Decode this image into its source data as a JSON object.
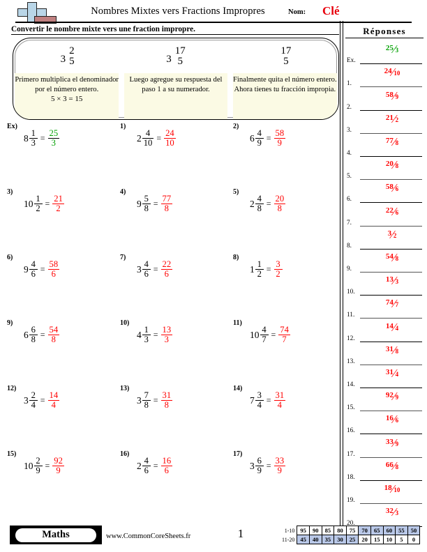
{
  "header": {
    "title": "Nombres Mixtes vers Fractions Impropres",
    "name_label": "Nom:",
    "name_value": "Clé",
    "logo_icon": "plus-book-icon"
  },
  "instruction": "Convertir le nombre mixte vers une fraction impropre.",
  "steps": [
    {
      "whole": "3",
      "num": "2",
      "den": "5",
      "text": "Primero multiplica el denominador por el número entero.",
      "calc": "5 × 3 = 15"
    },
    {
      "whole": "3",
      "num": "17",
      "den": "5",
      "text": "Luego agregue su respuesta del paso 1 a su numerador.",
      "calc": ""
    },
    {
      "whole": "",
      "num": "17",
      "den": "5",
      "text": "Finalmente quita el número entero. Ahora tienes tu fracción impropia.",
      "calc": ""
    }
  ],
  "problems": [
    {
      "num": "Ex)",
      "whole": "8",
      "n": "1",
      "d": "3",
      "an": "25",
      "ad": "3",
      "color": "green"
    },
    {
      "num": "1)",
      "whole": "2",
      "n": "4",
      "d": "10",
      "an": "24",
      "ad": "10",
      "color": "red"
    },
    {
      "num": "2)",
      "whole": "6",
      "n": "4",
      "d": "9",
      "an": "58",
      "ad": "9",
      "color": "red"
    },
    {
      "num": "3)",
      "whole": "10",
      "n": "1",
      "d": "2",
      "an": "21",
      "ad": "2",
      "color": "red"
    },
    {
      "num": "4)",
      "whole": "9",
      "n": "5",
      "d": "8",
      "an": "77",
      "ad": "8",
      "color": "red"
    },
    {
      "num": "5)",
      "whole": "2",
      "n": "4",
      "d": "8",
      "an": "20",
      "ad": "8",
      "color": "red"
    },
    {
      "num": "6)",
      "whole": "9",
      "n": "4",
      "d": "6",
      "an": "58",
      "ad": "6",
      "color": "red"
    },
    {
      "num": "7)",
      "whole": "3",
      "n": "4",
      "d": "6",
      "an": "22",
      "ad": "6",
      "color": "red"
    },
    {
      "num": "8)",
      "whole": "1",
      "n": "1",
      "d": "2",
      "an": "3",
      "ad": "2",
      "color": "red"
    },
    {
      "num": "9)",
      "whole": "6",
      "n": "6",
      "d": "8",
      "an": "54",
      "ad": "8",
      "color": "red"
    },
    {
      "num": "10)",
      "whole": "4",
      "n": "1",
      "d": "3",
      "an": "13",
      "ad": "3",
      "color": "red"
    },
    {
      "num": "11)",
      "whole": "10",
      "n": "4",
      "d": "7",
      "an": "74",
      "ad": "7",
      "color": "red"
    },
    {
      "num": "12)",
      "whole": "3",
      "n": "2",
      "d": "4",
      "an": "14",
      "ad": "4",
      "color": "red"
    },
    {
      "num": "13)",
      "whole": "3",
      "n": "7",
      "d": "8",
      "an": "31",
      "ad": "8",
      "color": "red"
    },
    {
      "num": "14)",
      "whole": "7",
      "n": "3",
      "d": "4",
      "an": "31",
      "ad": "4",
      "color": "red"
    },
    {
      "num": "15)",
      "whole": "10",
      "n": "2",
      "d": "9",
      "an": "92",
      "ad": "9",
      "color": "red"
    },
    {
      "num": "16)",
      "whole": "2",
      "n": "4",
      "d": "6",
      "an": "16",
      "ad": "6",
      "color": "red"
    },
    {
      "num": "17)",
      "whole": "3",
      "n": "6",
      "d": "9",
      "an": "33",
      "ad": "9",
      "color": "red"
    }
  ],
  "answers": {
    "title": "Réponses",
    "rows": [
      {
        "label": "Ex.",
        "n": "25",
        "d": "3",
        "color": "green"
      },
      {
        "label": "1.",
        "n": "24",
        "d": "10",
        "color": "red"
      },
      {
        "label": "2.",
        "n": "58",
        "d": "9",
        "color": "red"
      },
      {
        "label": "3.",
        "n": "21",
        "d": "2",
        "color": "red"
      },
      {
        "label": "4.",
        "n": "77",
        "d": "8",
        "color": "red"
      },
      {
        "label": "5.",
        "n": "20",
        "d": "8",
        "color": "red"
      },
      {
        "label": "6.",
        "n": "58",
        "d": "6",
        "color": "red"
      },
      {
        "label": "7.",
        "n": "22",
        "d": "6",
        "color": "red"
      },
      {
        "label": "8.",
        "n": "3",
        "d": "2",
        "color": "red"
      },
      {
        "label": "9.",
        "n": "54",
        "d": "8",
        "color": "red"
      },
      {
        "label": "10.",
        "n": "13",
        "d": "3",
        "color": "red"
      },
      {
        "label": "11.",
        "n": "74",
        "d": "7",
        "color": "red"
      },
      {
        "label": "12.",
        "n": "14",
        "d": "4",
        "color": "red"
      },
      {
        "label": "13.",
        "n": "31",
        "d": "8",
        "color": "red"
      },
      {
        "label": "14.",
        "n": "31",
        "d": "4",
        "color": "red"
      },
      {
        "label": "15.",
        "n": "92",
        "d": "9",
        "color": "red"
      },
      {
        "label": "16.",
        "n": "16",
        "d": "6",
        "color": "red"
      },
      {
        "label": "17.",
        "n": "33",
        "d": "9",
        "color": "red"
      },
      {
        "label": "18.",
        "n": "66",
        "d": "8",
        "color": "red"
      },
      {
        "label": "19.",
        "n": "18",
        "d": "10",
        "color": "red"
      },
      {
        "label": "20.",
        "n": "32",
        "d": "3",
        "color": "red"
      }
    ]
  },
  "footer": {
    "brand": "Maths",
    "site": "www.CommonCoreSheets.fr",
    "page": "1",
    "score_table": {
      "row1_label": "1-10",
      "row2_label": "11-20",
      "row1": [
        {
          "v": "95",
          "hl": false
        },
        {
          "v": "90",
          "hl": false
        },
        {
          "v": "85",
          "hl": false
        },
        {
          "v": "80",
          "hl": false
        },
        {
          "v": "75",
          "hl": false
        },
        {
          "v": "70",
          "hl": true
        },
        {
          "v": "65",
          "hl": true
        },
        {
          "v": "60",
          "hl": true
        },
        {
          "v": "55",
          "hl": true
        },
        {
          "v": "50",
          "hl": true
        }
      ],
      "row2": [
        {
          "v": "45",
          "hl": true
        },
        {
          "v": "40",
          "hl": true
        },
        {
          "v": "35",
          "hl": true
        },
        {
          "v": "30",
          "hl": true
        },
        {
          "v": "25",
          "hl": true
        },
        {
          "v": "20",
          "hl": false
        },
        {
          "v": "15",
          "hl": false
        },
        {
          "v": "10",
          "hl": false
        },
        {
          "v": "5",
          "hl": false
        },
        {
          "v": "0",
          "hl": false
        }
      ]
    }
  },
  "colors": {
    "answer_red": "#ff0000",
    "example_green": "#00a000",
    "highlight_blue": "#b9c8e8",
    "step_bg": "#fbfae4"
  }
}
